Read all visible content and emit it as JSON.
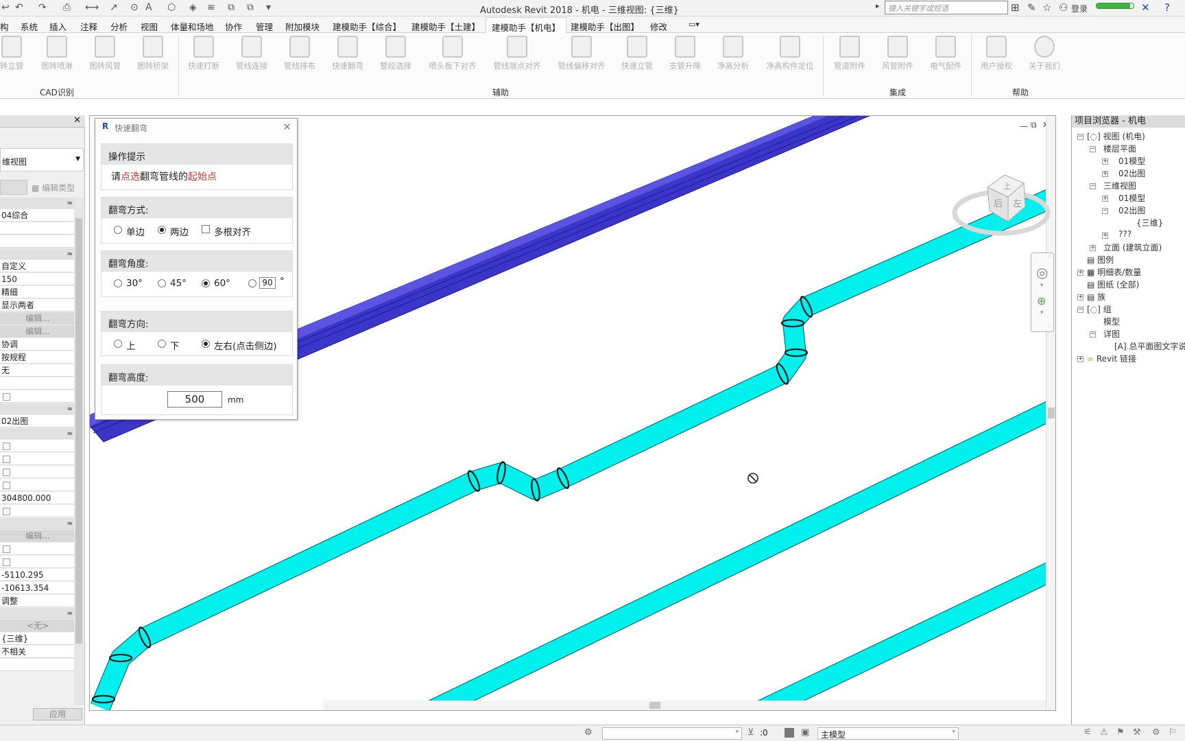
{
  "app": {
    "title": "Autodesk Revit 2018 -    机电 - 三维视图: {三维}",
    "search_placeholder": "键入关键字或短语",
    "login_label": "登录",
    "progress_fraction": 0.9
  },
  "tabs": [
    {
      "label": "构"
    },
    {
      "label": "系统"
    },
    {
      "label": "插入"
    },
    {
      "label": "注释"
    },
    {
      "label": "分析"
    },
    {
      "label": "视图"
    },
    {
      "label": "体量和场地"
    },
    {
      "label": "协作"
    },
    {
      "label": "管理"
    },
    {
      "label": "附加模块"
    },
    {
      "label": "建模助手【综合】"
    },
    {
      "label": "建模助手【土建】"
    },
    {
      "label": "建模助手【机电】"
    },
    {
      "label": "建模助手【出图】"
    },
    {
      "label": "修改"
    }
  ],
  "ribbon": {
    "buttons": [
      {
        "label": "转立管"
      },
      {
        "label": "图转喷淋"
      },
      {
        "label": "图转风管"
      },
      {
        "label": "图转桥架"
      },
      {
        "label": "快速打断"
      },
      {
        "label": "管线连接"
      },
      {
        "label": "管线排布"
      },
      {
        "label": "快速翻弯"
      },
      {
        "label": "整段选择"
      },
      {
        "label": "喷头板下对齐"
      },
      {
        "label": "管线端点对齐"
      },
      {
        "label": "管线偏移对齐"
      },
      {
        "label": "快速立管"
      },
      {
        "label": "支管升降"
      },
      {
        "label": "净高分析"
      },
      {
        "label": "净高构件定位"
      },
      {
        "label": "管道附件"
      },
      {
        "label": "风管附件"
      },
      {
        "label": "电气配件"
      },
      {
        "label": "用户授权"
      },
      {
        "label": "关于我们"
      }
    ],
    "panels": [
      {
        "label": "CAD识别"
      },
      {
        "label": "辅助"
      },
      {
        "label": "集成"
      },
      {
        "label": "帮助"
      }
    ]
  },
  "properties": {
    "type_selector": "维视图",
    "edit_type_label": "编辑类型",
    "rows": [
      {
        "value": "04综合"
      },
      {
        "value": ""
      },
      {
        "value": ""
      },
      {
        "value": "自定义"
      },
      {
        "value": "150"
      },
      {
        "value": "精细"
      },
      {
        "value": "显示两者"
      },
      {
        "value": "编辑..."
      },
      {
        "value": "编辑..."
      },
      {
        "value": "协调"
      },
      {
        "value": "按规程"
      },
      {
        "value": "无"
      },
      {
        "value": ""
      },
      {
        "value": "02出图"
      },
      {
        "value": "304800.000"
      },
      {
        "value": "编辑..."
      },
      {
        "value": "-5110.295"
      },
      {
        "value": "-10613.354"
      },
      {
        "value": "调整"
      },
      {
        "value": "<无>"
      },
      {
        "value": "{三维}"
      },
      {
        "value": "不相关"
      }
    ],
    "apply_label": "应用"
  },
  "dialog": {
    "title": "快速翻弯",
    "hint_header": "操作提示",
    "hint_parts": [
      "请",
      "点选",
      "翻弯管线的",
      "起始点"
    ],
    "mode_header": "翻弯方式:",
    "mode_options": [
      {
        "label": "单边",
        "selected": false
      },
      {
        "label": "两边",
        "selected": true
      },
      {
        "label": "多根对齐",
        "selected": false
      }
    ],
    "angle_header": "翻弯角度:",
    "angle_options": [
      {
        "label": "30°",
        "selected": false
      },
      {
        "label": "45°",
        "selected": false
      },
      {
        "label": "60°",
        "selected": true
      }
    ],
    "angle_custom_value": "90",
    "angle_custom_unit": "°",
    "direction_header": "翻弯方向:",
    "direction_options": [
      {
        "label": "上",
        "selected": false
      },
      {
        "label": "下",
        "selected": false
      },
      {
        "label": "左右(点击侧边)",
        "selected": true
      }
    ],
    "height_header": "翻弯高度:",
    "height_value": "500",
    "height_unit": "mm"
  },
  "viewcube": {
    "top_face": "上",
    "front_face": "后",
    "side_face": "左"
  },
  "browser": {
    "header": "项目浏览器 - 机电",
    "items": [
      {
        "label": "视图 (机电)"
      },
      {
        "label": "楼层平面"
      },
      {
        "label": "01模型"
      },
      {
        "label": "02出图"
      },
      {
        "label": "三维视图"
      },
      {
        "label": "01模型"
      },
      {
        "label": "02出图"
      },
      {
        "label": "{三维}"
      },
      {
        "label": "???"
      },
      {
        "label": "立面 (建筑立面)"
      },
      {
        "label": "图例"
      },
      {
        "label": "明细表/数量"
      },
      {
        "label": "图纸 (全部)"
      },
      {
        "label": "族"
      },
      {
        "label": "组"
      },
      {
        "label": "模型"
      },
      {
        "label": "详图"
      },
      {
        "label": "总平面图文字说明"
      },
      {
        "label": "Revit 链接"
      }
    ]
  },
  "statusbar": {
    "selection_count": ":0",
    "model_label": "主模型"
  },
  "colors": {
    "pipe": "#00f0ee",
    "pipe_stroke": "#005a5a",
    "duct": "#3b35c9",
    "duct_stroke": "#1f1a8a"
  },
  "icons": [
    "undo-icon",
    "redo-icon",
    "print-icon",
    "search-icon",
    "star-icon",
    "user-icon",
    "close-icon",
    "help-icon",
    "no-entry-icon"
  ]
}
